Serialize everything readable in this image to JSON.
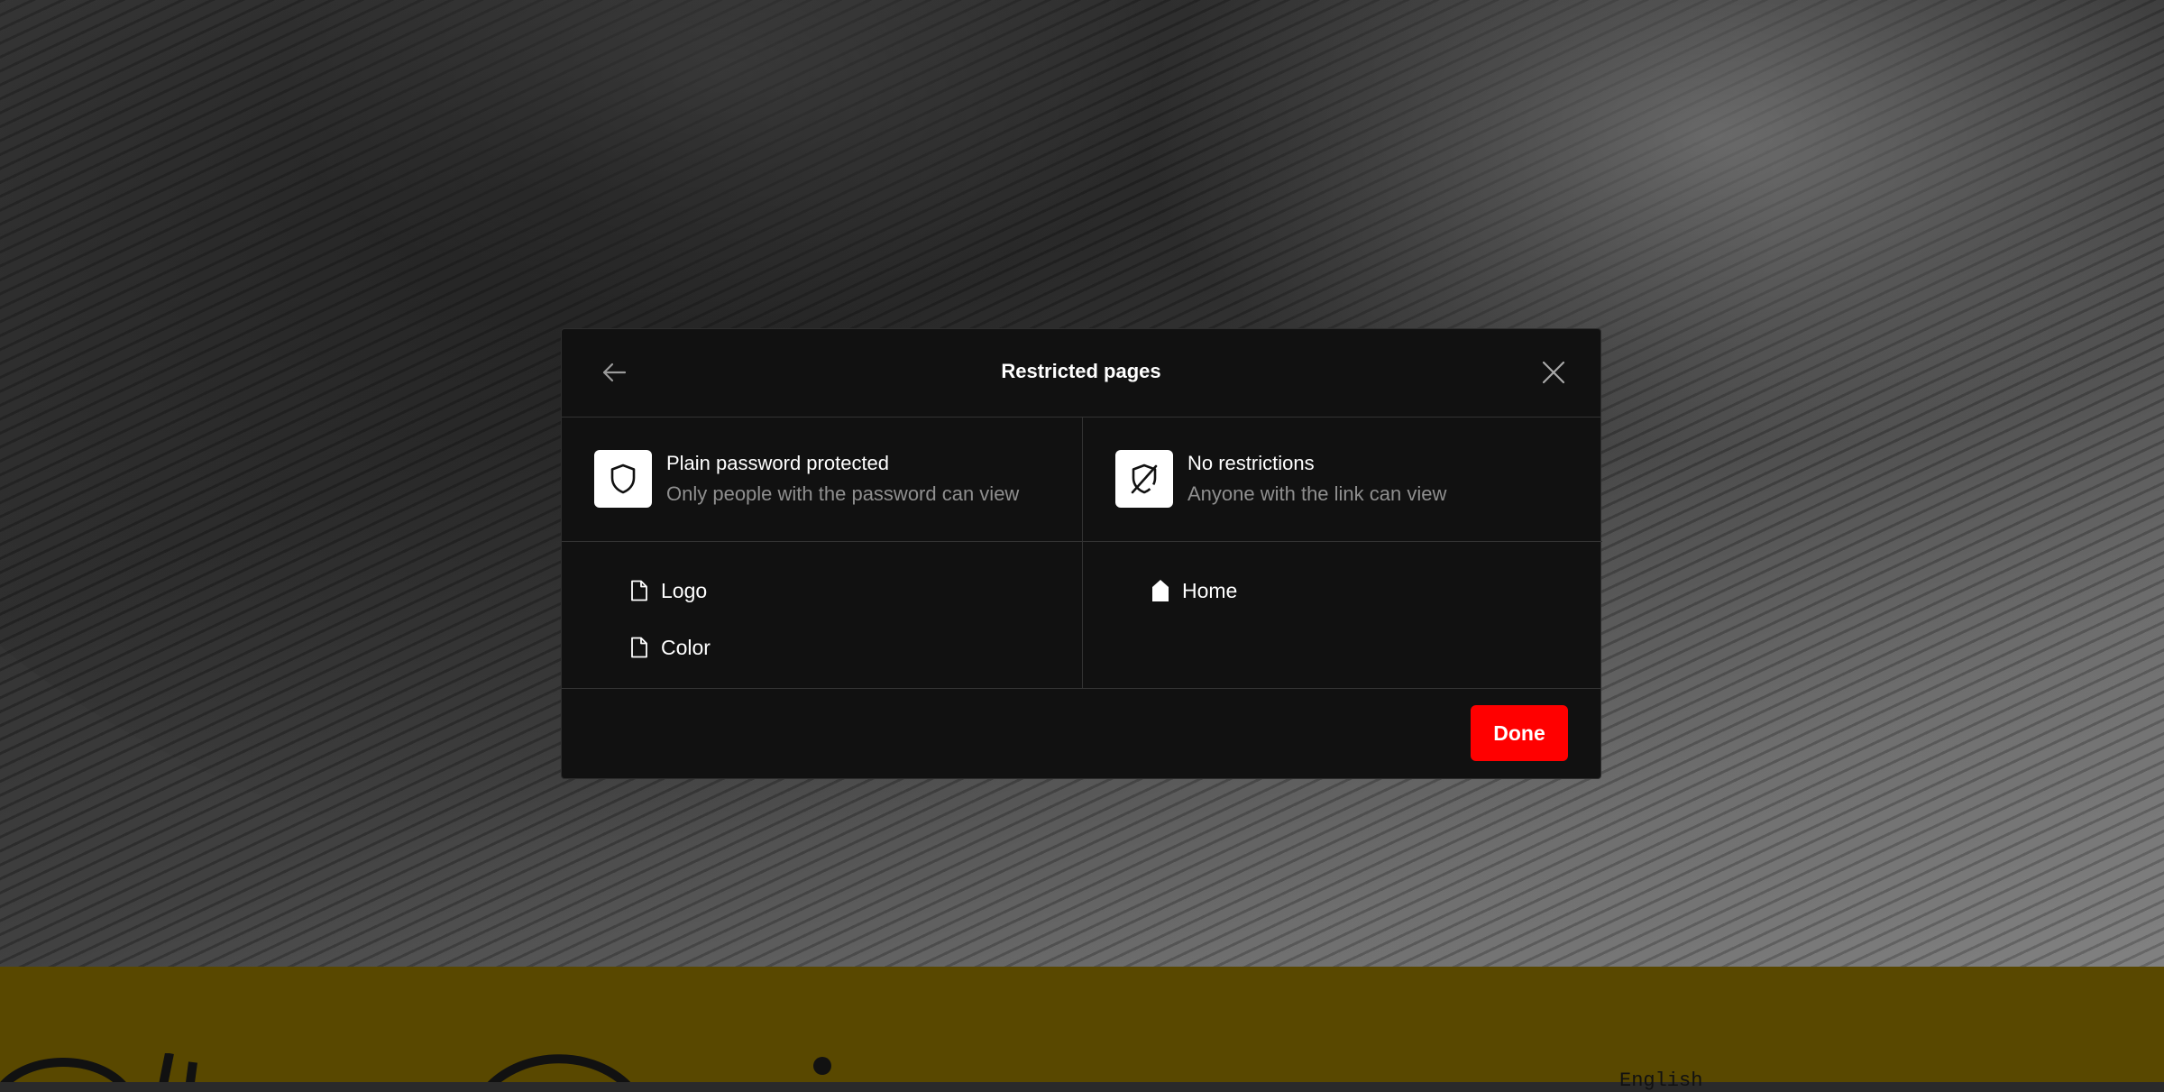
{
  "modal": {
    "title": "Restricted pages",
    "back_icon": "arrow-left-icon",
    "close_icon": "close-icon"
  },
  "columns": [
    {
      "title": "Plain password protected",
      "subtitle": "Only people with the password can view",
      "icon": "shield-icon",
      "pages": [
        {
          "label": "Logo",
          "icon": "file-icon"
        },
        {
          "label": "Color",
          "icon": "file-icon"
        }
      ]
    },
    {
      "title": "No restrictions",
      "subtitle": "Anyone with the link can view",
      "icon": "shield-off-icon",
      "pages": [
        {
          "label": "Home",
          "icon": "home-icon"
        }
      ]
    }
  ],
  "footer": {
    "done_label": "Done",
    "language": "English"
  },
  "colors": {
    "accent": "#ff0000",
    "modal_bg": "#111111",
    "footer_band": "#594800"
  }
}
